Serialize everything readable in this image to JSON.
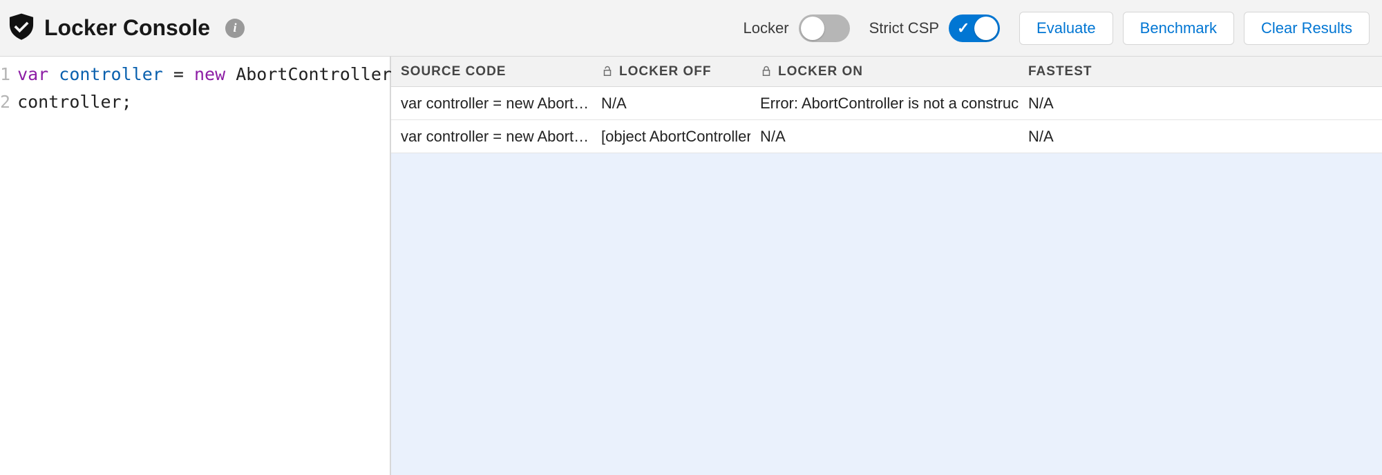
{
  "header": {
    "title": "Locker Console",
    "info_glyph": "i",
    "toggles": {
      "locker": {
        "label": "Locker",
        "on": false
      },
      "strict_csp": {
        "label": "Strict CSP",
        "on": true
      }
    },
    "buttons": {
      "evaluate": "Evaluate",
      "benchmark": "Benchmark",
      "clear": "Clear Results"
    }
  },
  "editor": {
    "lines": [
      {
        "num": "1",
        "tokens": [
          {
            "t": "var ",
            "c": "tok-keyword"
          },
          {
            "t": "controller ",
            "c": "tok-var"
          },
          {
            "t": "= ",
            "c": "tok-op"
          },
          {
            "t": "new ",
            "c": "tok-keyword"
          },
          {
            "t": "AbortController();",
            "c": "tok-class"
          }
        ]
      },
      {
        "num": "2",
        "tokens": [
          {
            "t": "controller;",
            "c": "tok-plain"
          }
        ]
      }
    ]
  },
  "results": {
    "columns": {
      "source": "Source Code",
      "off": "Locker Off",
      "on": "Locker On",
      "fastest": "Fastest"
    },
    "rows": [
      {
        "source": "var controller = new AbortC…",
        "off": "N/A",
        "on": "Error: AbortController is not a constructor",
        "fastest": "N/A"
      },
      {
        "source": "var controller = new AbortC…",
        "off": "[object AbortController]",
        "on": "N/A",
        "fastest": "N/A"
      }
    ]
  }
}
